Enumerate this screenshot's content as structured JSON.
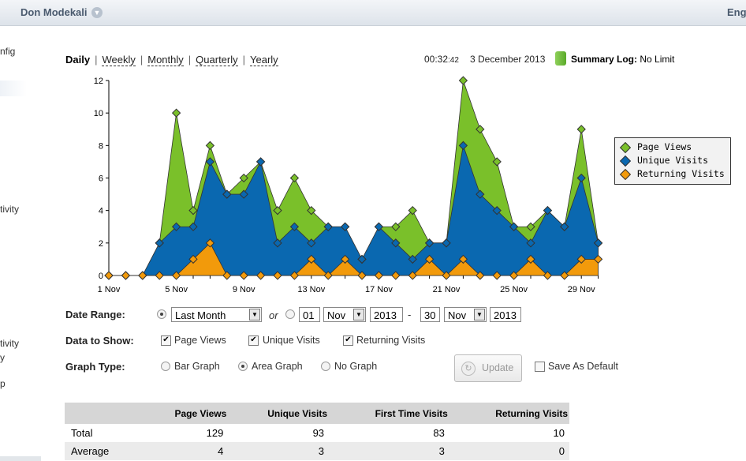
{
  "topbar": {
    "username": "Don Modekali",
    "lang": "Eng"
  },
  "sidebar_fragments": [
    "nfig",
    "tivity",
    "tivity",
    "y",
    "p"
  ],
  "periods": [
    "Daily",
    "Weekly",
    "Monthly",
    "Quarterly",
    "Yearly"
  ],
  "active_period": "Daily",
  "clock": {
    "hm": "00:32",
    "sec": ":42"
  },
  "date": "3 December 2013",
  "summary": {
    "label": "Summary Log:",
    "value": "No Limit"
  },
  "chart_data": {
    "type": "area",
    "x": [
      "1 Nov",
      "2 Nov",
      "3 Nov",
      "4 Nov",
      "5 Nov",
      "6 Nov",
      "7 Nov",
      "8 Nov",
      "9 Nov",
      "10 Nov",
      "11 Nov",
      "12 Nov",
      "13 Nov",
      "14 Nov",
      "15 Nov",
      "16 Nov",
      "17 Nov",
      "18 Nov",
      "19 Nov",
      "20 Nov",
      "21 Nov",
      "22 Nov",
      "23 Nov",
      "24 Nov",
      "25 Nov",
      "26 Nov",
      "27 Nov",
      "28 Nov",
      "29 Nov",
      "30 Nov"
    ],
    "tick_labels": [
      "1 Nov",
      "5 Nov",
      "9 Nov",
      "13 Nov",
      "17 Nov",
      "21 Nov",
      "25 Nov",
      "29 Nov"
    ],
    "ylim": [
      0,
      12
    ],
    "yticks": [
      0,
      2,
      4,
      6,
      8,
      10,
      12
    ],
    "grid": false,
    "legend_position": "right",
    "series": [
      {
        "name": "Page Views",
        "color": "#7ac02a",
        "values": [
          0,
          0,
          0,
          2,
          10,
          4,
          8,
          5,
          6,
          7,
          4,
          6,
          4,
          3,
          3,
          1,
          3,
          3,
          4,
          2,
          2,
          12,
          9,
          7,
          3,
          3,
          4,
          3,
          9,
          2
        ]
      },
      {
        "name": "Unique Visits",
        "color": "#0a68b0",
        "values": [
          0,
          0,
          0,
          2,
          3,
          3,
          7,
          5,
          5,
          7,
          2,
          3,
          2,
          3,
          3,
          1,
          3,
          2,
          1,
          2,
          2,
          8,
          5,
          4,
          3,
          2,
          4,
          3,
          6,
          2
        ]
      },
      {
        "name": "Returning Visits",
        "color": "#f29a0b",
        "values": [
          0,
          0,
          0,
          0,
          0,
          1,
          2,
          0,
          0,
          0,
          0,
          0,
          1,
          0,
          1,
          0,
          0,
          0,
          0,
          1,
          0,
          1,
          0,
          0,
          0,
          1,
          0,
          0,
          1,
          1
        ]
      }
    ]
  },
  "controls": {
    "date_range_label": "Date Range:",
    "range_option": "Last Month",
    "or_text": "or",
    "from": {
      "day": "01",
      "month": "Nov",
      "year": "2013"
    },
    "dash": "-",
    "to": {
      "day": "30",
      "month": "Nov",
      "year": "2013"
    },
    "data_label": "Data to Show:",
    "data_options": [
      "Page Views",
      "Unique Visits",
      "Returning Visits"
    ],
    "graph_label": "Graph Type:",
    "graph_options": [
      "Bar Graph",
      "Area Graph",
      "No Graph"
    ],
    "graph_selected": "Area Graph",
    "update": "Update",
    "save_default": "Save As Default"
  },
  "stats": {
    "headers": [
      "",
      "Page Views",
      "Unique Visits",
      "First Time Visits",
      "Returning Visits"
    ],
    "rows": [
      [
        "Total",
        "129",
        "93",
        "83",
        "10"
      ],
      [
        "Average",
        "4",
        "3",
        "3",
        "0"
      ]
    ]
  }
}
